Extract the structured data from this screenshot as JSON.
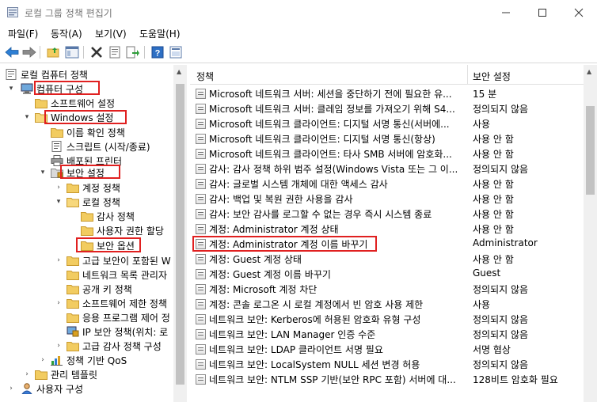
{
  "window": {
    "title": "로컬 그룹 정책 편집기"
  },
  "menu": [
    "파일(F)",
    "동작(A)",
    "보기(V)",
    "도움말(H)"
  ],
  "toolbar_icons": [
    "back-arrow-icon",
    "forward-arrow-icon",
    "folder-up-icon",
    "show-tree-icon",
    "delete-icon",
    "properties-icon",
    "export-list-icon",
    "help-icon",
    "view-icon"
  ],
  "tree": {
    "items": [
      {
        "label": "로컬 컴퓨터 정책",
        "icon": "computer-policy-icon"
      },
      {
        "label": "컴퓨터 구성",
        "icon": "computer-icon"
      },
      {
        "label": "소프트웨어 설정",
        "icon": "folder-icon"
      },
      {
        "label": "Windows 설정",
        "icon": "folder-open-icon"
      },
      {
        "label": "이름 확인 정책",
        "icon": "folder-icon"
      },
      {
        "label": "스크립트 (시작/종료)",
        "icon": "script-icon"
      },
      {
        "label": "배포된 프린터",
        "icon": "printer-icon"
      },
      {
        "label": "보안 설정",
        "icon": "security-settings-icon"
      },
      {
        "label": "계정 정책",
        "icon": "folder-icon"
      },
      {
        "label": "로컬 정책",
        "icon": "folder-open-icon"
      },
      {
        "label": "감사 정책",
        "icon": "folder-icon"
      },
      {
        "label": "사용자 권한 할당",
        "icon": "folder-icon"
      },
      {
        "label": "보안 옵션",
        "icon": "folder-icon"
      },
      {
        "label": "고급 보안이 포함된 W",
        "icon": "folder-icon"
      },
      {
        "label": "네트워크 목록 관리자",
        "icon": "folder-icon"
      },
      {
        "label": "공개 키 정책",
        "icon": "folder-icon"
      },
      {
        "label": "소프트웨어 제한 정책",
        "icon": "folder-icon"
      },
      {
        "label": "응용 프로그램 제어 정",
        "icon": "folder-icon"
      },
      {
        "label": "IP 보안 정책(위치: 로",
        "icon": "ip-security-icon"
      },
      {
        "label": "고급 감사 정책 구성",
        "icon": "folder-icon"
      },
      {
        "label": "정책 기반 QoS",
        "icon": "qos-chart-icon"
      },
      {
        "label": "관리 템플릿",
        "icon": "folder-icon"
      },
      {
        "label": "사용자 구성",
        "icon": "user-icon"
      }
    ]
  },
  "list": {
    "columns": {
      "policy": "정책",
      "setting": "보안 설정"
    },
    "rows": [
      {
        "name": "Microsoft 네트워크 서버: 세션을 중단하기 전에 필요한 유...",
        "value": "15 분"
      },
      {
        "name": "Microsoft 네트워크 서버: 클레임 정보를 가져오기 위해 S4...",
        "value": "정의되지 않음"
      },
      {
        "name": "Microsoft 네트워크 클라이언트: 디지털 서명 통신(서버에...",
        "value": "사용"
      },
      {
        "name": "Microsoft 네트워크 클라이언트: 디지털 서명 통신(항상)",
        "value": "사용 안 함"
      },
      {
        "name": "Microsoft 네트워크 클라이언트: 타사 SMB 서버에 암호화...",
        "value": "사용 안 함"
      },
      {
        "name": "감사: 감사 정책 하위 범주 설정(Windows Vista 또는 그 이...",
        "value": "정의되지 않음"
      },
      {
        "name": "감사: 글로벌 시스템 개체에 대한 액세스 감사",
        "value": "사용 안 함"
      },
      {
        "name": "감사: 백업 및 복원 권한 사용을 감사",
        "value": "사용 안 함"
      },
      {
        "name": "감사: 보안 감사를 로그할 수 없는 경우 즉시 시스템 종료",
        "value": "사용 안 함"
      },
      {
        "name": "계정: Administrator 계정 상태",
        "value": "사용 안 함"
      },
      {
        "name": "계정: Administrator 계정 이름 바꾸기",
        "value": "Administrator"
      },
      {
        "name": "계정: Guest 계정 상태",
        "value": "사용 안 함"
      },
      {
        "name": "계정: Guest 계정 이름 바꾸기",
        "value": "Guest"
      },
      {
        "name": "계정: Microsoft 계정 차단",
        "value": "정의되지 않음"
      },
      {
        "name": "계정: 콘솔 로그온 시 로컬 계정에서 빈 암호 사용 제한",
        "value": "사용"
      },
      {
        "name": "네트워크 보안: Kerberos에 허용된 암호화 유형 구성",
        "value": "정의되지 않음"
      },
      {
        "name": "네트워크 보안: LAN Manager 인증 수준",
        "value": "정의되지 않음"
      },
      {
        "name": "네트워크 보안: LDAP 클라이언트 서명 필요",
        "value": "서명 협상"
      },
      {
        "name": "네트워크 보안: LocalSystem NULL 세션 변경 허용",
        "value": "정의되지 않음"
      },
      {
        "name": "네트워크 보안: NTLM SSP 기반(보안 RPC 포함) 서버에 대...",
        "value": "128비트 암호화 필요"
      }
    ]
  },
  "colors": {
    "highlight": "#e02020",
    "accent": "#1e72c8"
  }
}
